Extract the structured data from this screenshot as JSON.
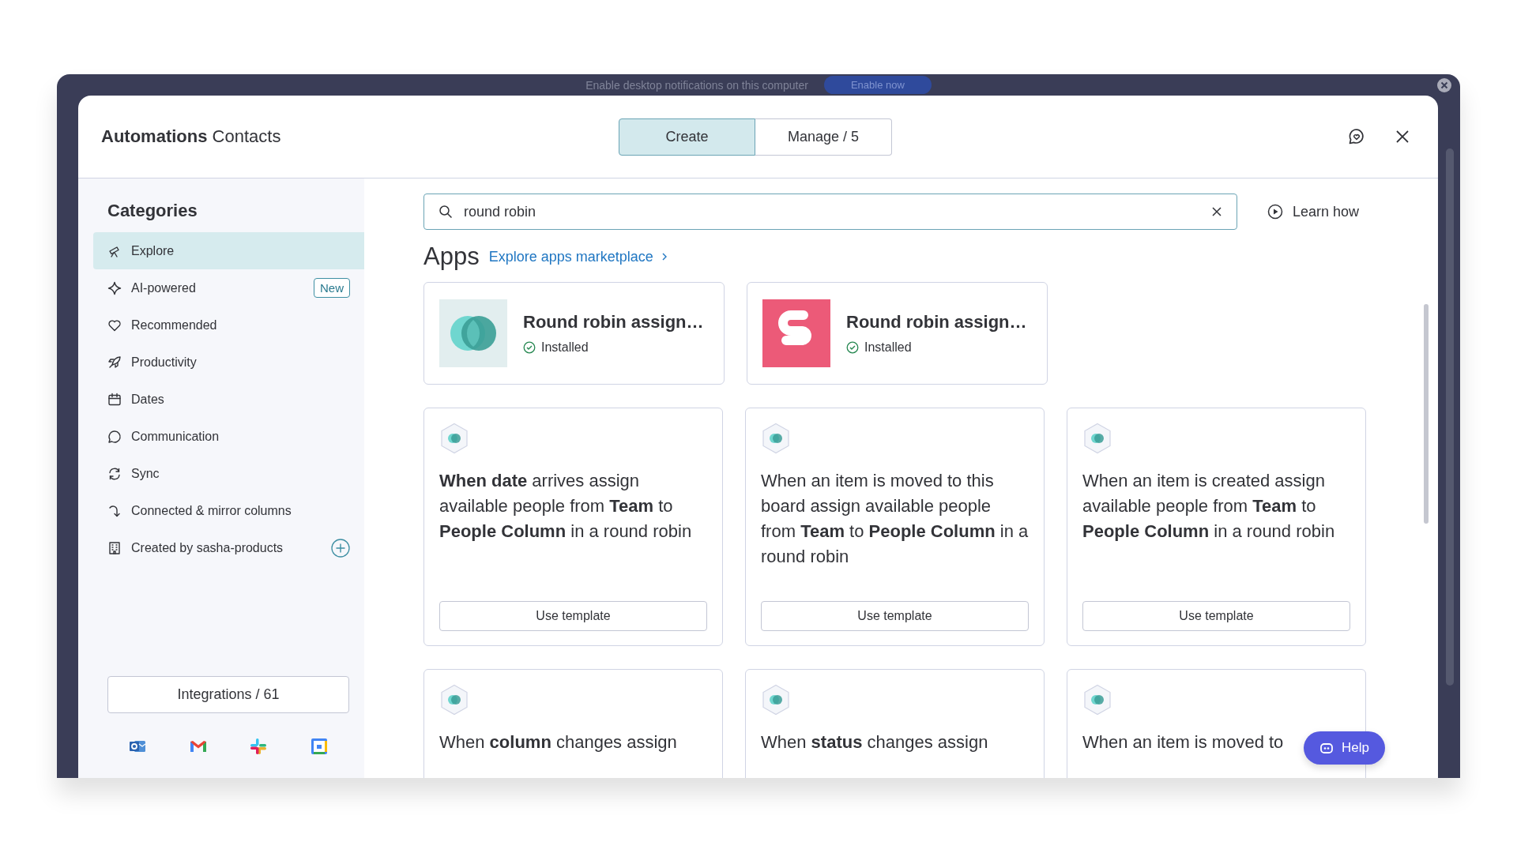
{
  "banner": {
    "text": "Enable desktop notifications on this computer",
    "button": "Enable now"
  },
  "header": {
    "title_bold": "Automations",
    "title": "Contacts",
    "tabs": [
      {
        "label": "Create",
        "selected": true
      },
      {
        "label": "Manage / 5",
        "selected": false
      }
    ]
  },
  "sidebar": {
    "heading": "Categories",
    "items": [
      {
        "label": "Explore",
        "selected": true
      },
      {
        "label": "AI-powered",
        "selected": false,
        "badge": "New"
      },
      {
        "label": "Recommended",
        "selected": false
      },
      {
        "label": "Productivity",
        "selected": false
      },
      {
        "label": "Dates",
        "selected": false
      },
      {
        "label": "Communication",
        "selected": false
      },
      {
        "label": "Sync",
        "selected": false
      },
      {
        "label": "Connected & mirror columns",
        "selected": false
      },
      {
        "label": "Created by sasha-products",
        "selected": false,
        "add": true
      }
    ],
    "integrations": "Integrations / 61"
  },
  "search": {
    "value": "round robin"
  },
  "learn_how": "Learn how",
  "apps": {
    "heading": "Apps",
    "link": "Explore apps marketplace",
    "items": [
      {
        "name": "Round robin assign…",
        "status": "Installed"
      },
      {
        "name": "Round robin assign…",
        "status": "Installed"
      }
    ]
  },
  "templates": [
    {
      "text": "**When date** arrives assign available people from **Team** to **People Column** in a round robin",
      "button": "Use template"
    },
    {
      "text": "When an item is moved to this board assign available people from **Team** to **People Column** in a round robin",
      "button": "Use template"
    },
    {
      "text": "When an item is created assign available people from **Team** to **People Column** in a round robin",
      "button": "Use template"
    },
    {
      "text": "When **column** changes assign"
    },
    {
      "text": "When **status** changes assign"
    },
    {
      "text": "When an item is moved to"
    }
  ],
  "help": "Help"
}
